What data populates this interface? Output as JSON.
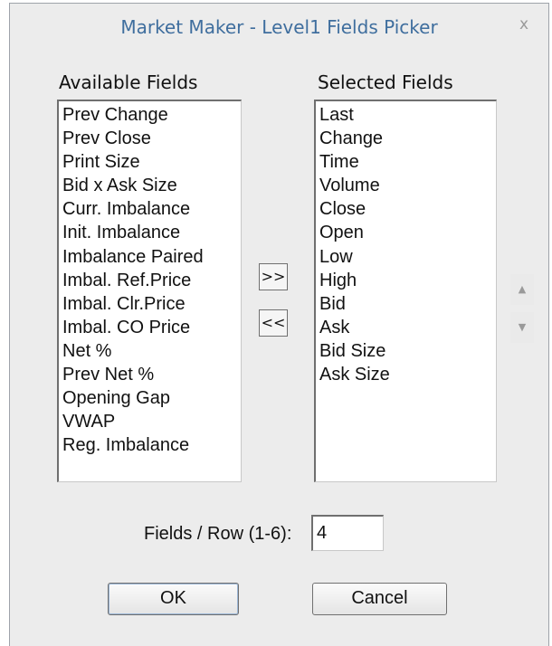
{
  "window": {
    "title": "Market Maker - Level1 Fields Picker",
    "close_label": "x"
  },
  "available": {
    "label": "Available Fields",
    "items": [
      "Prev Change",
      "Prev Close",
      "Print Size",
      "Bid x Ask Size",
      "Curr. Imbalance",
      "Init. Imbalance",
      "Imbalance Paired",
      "Imbal. Ref.Price",
      "Imbal. Clr.Price",
      "Imbal. CO Price",
      "Net %",
      "Prev Net %",
      "Opening Gap",
      "VWAP",
      "Reg. Imbalance"
    ]
  },
  "selected": {
    "label": "Selected Fields",
    "items": [
      "Last",
      "Change",
      "Time",
      "Volume",
      "Close",
      "Open",
      "Low",
      "High",
      "Bid",
      "Ask",
      "Bid Size",
      "Ask Size"
    ]
  },
  "buttons": {
    "add": ">>",
    "remove": "<<",
    "up": "▲",
    "down": "▼",
    "ok": "OK",
    "cancel": "Cancel"
  },
  "fields_per_row": {
    "label": "Fields / Row (1-6):",
    "value": "4"
  }
}
